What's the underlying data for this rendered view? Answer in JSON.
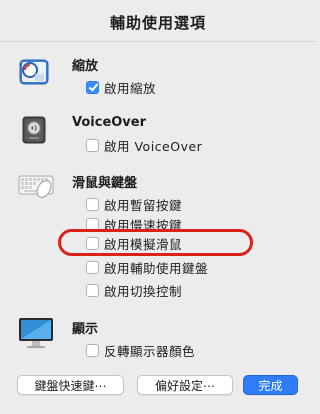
{
  "dialog": {
    "title": "輔助使用選項"
  },
  "sections": {
    "zoom": {
      "title": "縮放",
      "icon": "zoom-icon",
      "options": [
        {
          "label": "啟用縮放",
          "checked": true
        }
      ]
    },
    "voiceover": {
      "title": "VoiceOver",
      "icon": "voiceover-icon",
      "options": [
        {
          "label": "啟用 VoiceOver",
          "checked": false
        }
      ]
    },
    "mouse_keyboard": {
      "title": "滑鼠與鍵盤",
      "icon": "keyboard-mouse-icon",
      "options": [
        {
          "label": "啟用暫留按鍵",
          "checked": false
        },
        {
          "label": "啟用慢速按鍵",
          "checked": false
        },
        {
          "label": "啟用模擬滑鼠",
          "checked": false
        },
        {
          "label": "啟用輔助使用鍵盤",
          "checked": false
        },
        {
          "label": "啟用切換控制",
          "checked": false
        }
      ]
    },
    "display": {
      "title": "顯示",
      "icon": "display-icon",
      "options": [
        {
          "label": "反轉顯示器顏色",
          "checked": false
        }
      ]
    }
  },
  "buttons": {
    "keyboard_shortcuts": "鍵盤快速鍵⋯",
    "preferences": "偏好設定⋯",
    "done": "完成"
  },
  "colors": {
    "accent": "#2e7cf7",
    "highlight_ring": "#d8231b",
    "background": "#ececec"
  }
}
